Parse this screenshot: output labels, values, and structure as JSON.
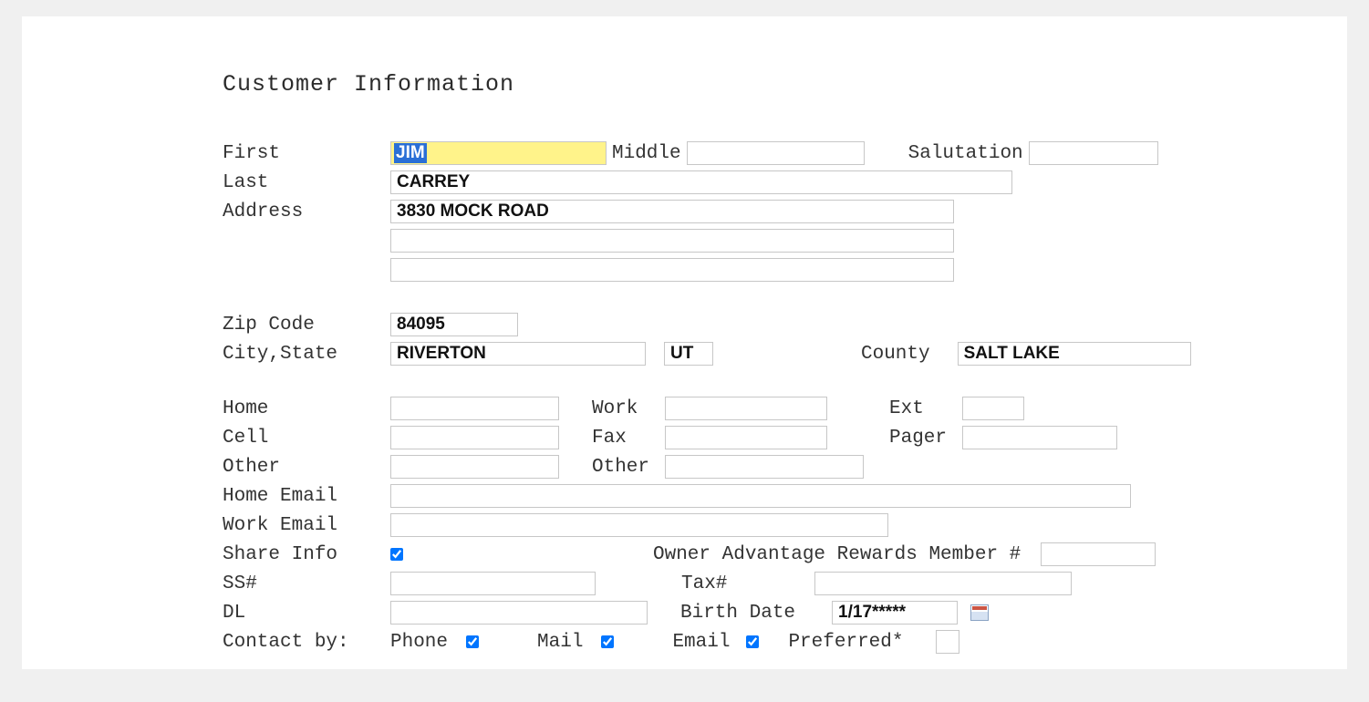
{
  "title": "Customer Information",
  "labels": {
    "first": "First",
    "middle": "Middle",
    "salutation": "Salutation",
    "last": "Last",
    "address": "Address",
    "zip": "Zip Code",
    "citystate": "City,State",
    "county": "County",
    "home": "Home",
    "work": "Work",
    "ext": "Ext",
    "cell": "Cell",
    "fax": "Fax",
    "pager": "Pager",
    "other": "Other",
    "other2": "Other",
    "homeemail": "Home Email",
    "workemail": "Work Email",
    "shareinfo": "Share Info",
    "oarm": "Owner Advantage Rewards Member #",
    "ssn": "SS#",
    "taxn": "Tax#",
    "dl": "DL",
    "birthdate": "Birth Date",
    "contactby": "Contact by:",
    "phone": "Phone",
    "mail": "Mail",
    "email": "Email",
    "preferred": "Preferred*"
  },
  "values": {
    "first": "JIM",
    "middle": "",
    "salutation": "",
    "last": "CARREY",
    "address1": "3830 MOCK ROAD",
    "address2": "",
    "address3": "",
    "zip": "84095",
    "city": "RIVERTON",
    "state": "UT",
    "county": "SALT LAKE",
    "home": "",
    "work": "",
    "ext": "",
    "cell": "",
    "fax": "",
    "pager": "",
    "other": "",
    "other2": "",
    "homeemail": "",
    "workemail": "",
    "oarm": "",
    "ssn": "",
    "taxn": "",
    "dl": "",
    "birthdate": "1/17*****",
    "preferred": ""
  },
  "checks": {
    "shareinfo": true,
    "phone": true,
    "mail": true,
    "email": true
  }
}
